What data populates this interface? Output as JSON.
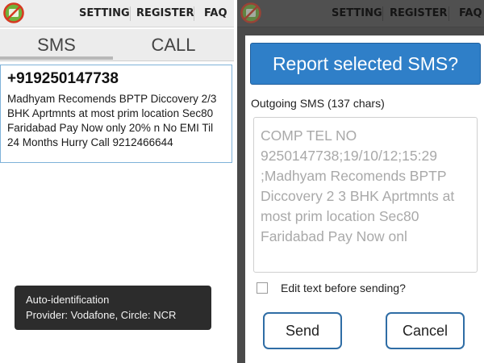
{
  "left": {
    "menu": [
      "SETTING",
      "REGISTER",
      "FAQ"
    ],
    "tabs": {
      "sms": "SMS",
      "call": "CALL"
    },
    "sms": {
      "number": "+919250147738",
      "body": "Madhyam Recomends BPTP Diccovery 2/3 BHK Aprtmnts at most prim location Sec80 Faridabad Pay Now only 20% n No EMI Til 24 Months Hurry Call 9212466644"
    },
    "toast": {
      "line1": "Auto-identification",
      "line2": "Provider: Vodafone, Circle: NCR"
    }
  },
  "right": {
    "menu": [
      "SETTING",
      "REGISTER",
      "FAQ"
    ],
    "dialog": {
      "title": "Report selected SMS?",
      "subtitle": "Outgoing SMS (137 chars)",
      "text": "COMP TEL NO 9250147738;19/10/12;15:29 ;Madhyam Recomends BPTP Diccovery 2 3 BHK Aprtmnts at most prim location Sec80 Faridabad Pay Now onl",
      "checkbox_label": "Edit text before sending?",
      "send_label": "Send",
      "cancel_label": "Cancel"
    }
  },
  "colors": {
    "accent_blue": "#2f7fc8",
    "dim_overlay": "#4a4a4a",
    "toast_bg": "#2c2c2c",
    "card_border": "#7fb2d9"
  },
  "icons": {
    "app": "no-spam-icon"
  }
}
